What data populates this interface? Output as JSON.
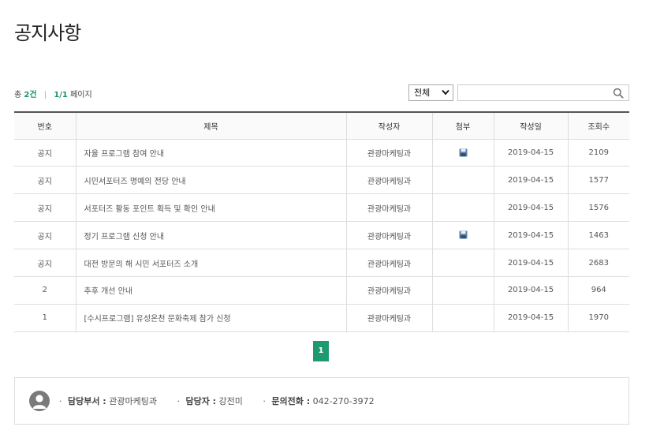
{
  "page": {
    "title": "공지사항"
  },
  "summary": {
    "total_prefix": "총",
    "total_count": "2건",
    "page_current": "1/1",
    "page_suffix": "페이지"
  },
  "search": {
    "filter_selected": "전체",
    "filter_options": [
      "전체"
    ],
    "query": "",
    "placeholder": ""
  },
  "table": {
    "headers": [
      "번호",
      "제목",
      "작성자",
      "첨부",
      "작성일",
      "조회수"
    ],
    "rows": [
      {
        "num": "공지",
        "subject": "자율 프로그램 참여 안내",
        "author": "관광마케팅과",
        "attach": true,
        "date": "2019-04-15",
        "views": "2109"
      },
      {
        "num": "공지",
        "subject": "시민서포터즈 명예의 전당 안내",
        "author": "관광마케팅과",
        "attach": false,
        "date": "2019-04-15",
        "views": "1577"
      },
      {
        "num": "공지",
        "subject": "서포터즈 활동 포인트 획득 및 확인 안내",
        "author": "관광마케팅과",
        "attach": false,
        "date": "2019-04-15",
        "views": "1576"
      },
      {
        "num": "공지",
        "subject": "정기 프로그램 신청 안내",
        "author": "관광마케팅과",
        "attach": true,
        "date": "2019-04-15",
        "views": "1463"
      },
      {
        "num": "공지",
        "subject": "대전 방문의 해 시민 서포터즈 소개",
        "author": "관광마케팅과",
        "attach": false,
        "date": "2019-04-15",
        "views": "2683"
      },
      {
        "num": "2",
        "subject": "추후 개선 안내",
        "author": "관광마케팅과",
        "attach": false,
        "date": "2019-04-15",
        "views": "964"
      },
      {
        "num": "1",
        "subject": "[수시프로그램] 유성온천 문화축제 참가 신청",
        "author": "관광마케팅과",
        "attach": false,
        "date": "2019-04-15",
        "views": "1970"
      }
    ]
  },
  "pagination": {
    "current": "1"
  },
  "contact": {
    "dept_label": "담당부서 :",
    "dept_value": "관광마케팅과",
    "person_label": "담당자 :",
    "person_value": "강전미",
    "phone_label": "문의전화 :",
    "phone_value": "042-270-3972"
  },
  "icons": {
    "attach": "floppy-disk-icon",
    "search": "search-icon",
    "dropdown": "chevron-down-icon",
    "avatar": "user-avatar-icon"
  },
  "colors": {
    "accent": "#1f9a6f",
    "summary_number": "#1a9070",
    "header_border": "#555555",
    "avatar": "#7a7a7a"
  }
}
